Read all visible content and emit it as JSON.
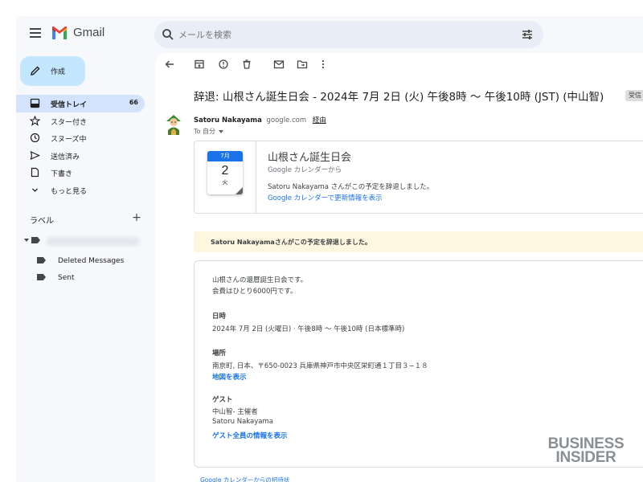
{
  "app": {
    "name": "Gmail",
    "brand_colors": {
      "red": "#ea4335",
      "blue": "#4285f4",
      "green": "#34a853",
      "yellow": "#fbbc04"
    }
  },
  "search": {
    "placeholder": "メールを検索",
    "icon": "search-icon",
    "options_icon": "tune-icon"
  },
  "compose": {
    "label": "作成"
  },
  "nav": {
    "items": [
      {
        "label": "受信トレイ",
        "count": "66",
        "icon": "inbox-icon",
        "active": true
      },
      {
        "label": "スター付き",
        "count": "",
        "icon": "star-icon"
      },
      {
        "label": "スヌーズ中",
        "count": "",
        "icon": "clock-icon"
      },
      {
        "label": "送信済み",
        "count": "",
        "icon": "send-icon"
      },
      {
        "label": "下書き",
        "count": "",
        "icon": "draft-icon"
      },
      {
        "label": "もっと見る",
        "count": "",
        "icon": "chevron-down-icon"
      }
    ]
  },
  "labels": {
    "heading": "ラベル",
    "add_symbol": "+",
    "items": [
      {
        "label": "Deleted Messages"
      },
      {
        "label": "Sent"
      }
    ]
  },
  "toolbar": {
    "icons": [
      "back-arrow-icon",
      "archive-icon",
      "report-spam-icon",
      "delete-icon",
      "mark-unread-icon",
      "move-to-icon",
      "more-vert-icon"
    ]
  },
  "email": {
    "subject": "辞退: 山根さん誕生日会 - 2024年 7月 2日 (火) 午後8時 〜 午後10時 (JST) (中山智)",
    "inbox_chip": "受信トレイ",
    "sender_name": "Satoru Nakayama",
    "sender_domain": "google.com",
    "via_label": "経由",
    "recipients": "To 自分"
  },
  "event_card": {
    "month": "7月",
    "day": "2",
    "weekday": "火",
    "title": "山根さん誕生日会",
    "subtitle": "Google カレンダーから",
    "message": "Satoru Nakayama さんがこの予定を辞退しました。",
    "link": "Google カレンダーで更新情報を表示"
  },
  "banner": {
    "text": "Satoru Nakayamaさんがこの予定を辞退しました。"
  },
  "details": {
    "desc_line1": "山根さんの還暦誕生日会です。",
    "desc_line2": "会費はひとり6000円です。",
    "when_label": "日時",
    "when_value": "2024年 7月 2日 (火曜日) ⋅ 午後8時 〜 午後10時 (日本標準時)",
    "where_label": "場所",
    "where_value": "南京町, 日本、〒650-0023 兵庫県神戸市中央区栄町通１丁目３−１８",
    "map_link": "地図を表示",
    "guests_label": "ゲスト",
    "guest_1": "中山智- 主催者",
    "guest_2": "Satoru Nakayama",
    "guests_link": "ゲスト全員の情報を表示"
  },
  "footer": {
    "text": "Google カレンダーからの招待状"
  },
  "watermark": {
    "line1": "BUSINESS",
    "line2": "INSIDER"
  }
}
